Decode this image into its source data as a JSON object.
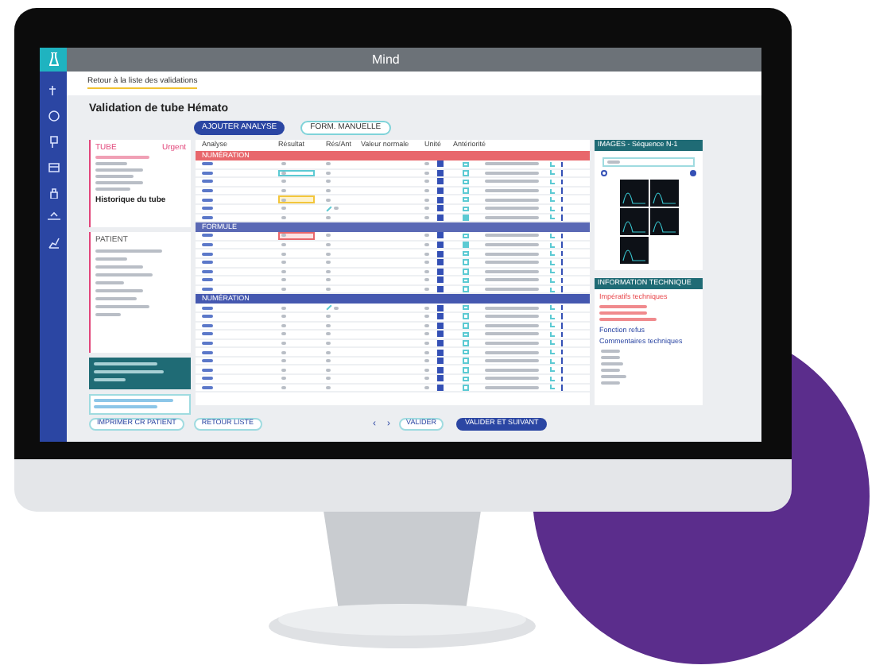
{
  "app": {
    "logo": "Mind",
    "breadcrumb": "Retour à la liste des validations",
    "title": "Validation de tube Hémato"
  },
  "toolbar": {
    "buttons": [
      "AJOUTER ANALYSE",
      "FORM. MANUELLE"
    ]
  },
  "tube_card": {
    "label": "TUBE",
    "urgent": "Urgent",
    "history_link": "Historique du tube"
  },
  "patient_card": {
    "label": "PATIENT"
  },
  "table": {
    "columns": [
      "Analyse",
      "Résultat",
      "Rés/Ant",
      "Valeur normale",
      "Unité",
      "Antériorité"
    ],
    "groups": [
      {
        "label": "NUMÉRATION",
        "color": "#e8676c",
        "rows": [
          {
            "focused": false,
            "warning": false,
            "alert": false,
            "validated": true,
            "reviewed": false,
            "trend": false
          },
          {
            "focused": true,
            "warning": false,
            "alert": false,
            "validated": true,
            "reviewed": false,
            "trend": false
          },
          {
            "focused": false,
            "warning": false,
            "alert": false,
            "validated": true,
            "reviewed": false,
            "trend": false
          },
          {
            "focused": false,
            "warning": false,
            "alert": false,
            "validated": true,
            "reviewed": false,
            "trend": false
          },
          {
            "focused": false,
            "warning": true,
            "alert": false,
            "validated": true,
            "reviewed": false,
            "trend": false
          },
          {
            "focused": false,
            "warning": false,
            "alert": false,
            "validated": true,
            "reviewed": false,
            "trend": true
          },
          {
            "focused": false,
            "warning": false,
            "alert": false,
            "validated": true,
            "reviewed": true,
            "trend": false
          }
        ]
      },
      {
        "label": "FORMULE",
        "color": "#5a69b5",
        "rows": [
          {
            "focused": false,
            "warning": false,
            "alert": true,
            "validated": true,
            "reviewed": false,
            "trend": false
          },
          {
            "focused": false,
            "warning": false,
            "alert": false,
            "validated": true,
            "reviewed": true,
            "trend": false
          },
          {
            "focused": false,
            "warning": false,
            "alert": false,
            "validated": true,
            "reviewed": false,
            "trend": false
          },
          {
            "focused": false,
            "warning": false,
            "alert": false,
            "validated": true,
            "reviewed": false,
            "trend": false
          },
          {
            "focused": false,
            "warning": false,
            "alert": false,
            "validated": true,
            "reviewed": false,
            "trend": false
          },
          {
            "focused": false,
            "warning": false,
            "alert": false,
            "validated": true,
            "reviewed": false,
            "trend": false
          },
          {
            "focused": false,
            "warning": false,
            "alert": false,
            "validated": true,
            "reviewed": false,
            "trend": false
          }
        ]
      },
      {
        "label": "NUMÉRATION",
        "color": "#4558b0",
        "rows": [
          {
            "focused": false,
            "warning": false,
            "alert": false,
            "validated": true,
            "reviewed": false,
            "trend": true
          },
          {
            "focused": false,
            "warning": false,
            "alert": false,
            "validated": true,
            "reviewed": false,
            "trend": false
          },
          {
            "focused": false,
            "warning": false,
            "alert": false,
            "validated": true,
            "reviewed": false,
            "trend": false
          },
          {
            "focused": false,
            "warning": false,
            "alert": false,
            "validated": true,
            "reviewed": false,
            "trend": false
          },
          {
            "focused": false,
            "warning": false,
            "alert": false,
            "validated": true,
            "reviewed": false,
            "trend": false
          },
          {
            "focused": false,
            "warning": false,
            "alert": false,
            "validated": true,
            "reviewed": false,
            "trend": false
          },
          {
            "focused": false,
            "warning": false,
            "alert": false,
            "validated": true,
            "reviewed": false,
            "trend": false
          },
          {
            "focused": false,
            "warning": false,
            "alert": false,
            "validated": true,
            "reviewed": false,
            "trend": false
          },
          {
            "focused": false,
            "warning": false,
            "alert": false,
            "validated": true,
            "reviewed": false,
            "trend": false
          },
          {
            "focused": false,
            "warning": false,
            "alert": false,
            "validated": true,
            "reviewed": false,
            "trend": false
          }
        ]
      }
    ]
  },
  "images_panel": {
    "title": "IMAGES - Séquence N-1",
    "view_options": [
      {
        "selected": false
      },
      {
        "selected": true
      }
    ]
  },
  "tech_panel": {
    "title": "INFORMATION TECHNIQUE",
    "imperatives": "Impératifs techniques",
    "refusal": "Fonction refus",
    "comments": "Commentaires techniques"
  },
  "footer": {
    "print": "IMPRIMER CR PATIENT",
    "back": "RETOUR LISTE",
    "prev": "‹",
    "next": "›",
    "validate": "VALIDER",
    "validate_next": "VALIDER ET SUIVANT"
  }
}
